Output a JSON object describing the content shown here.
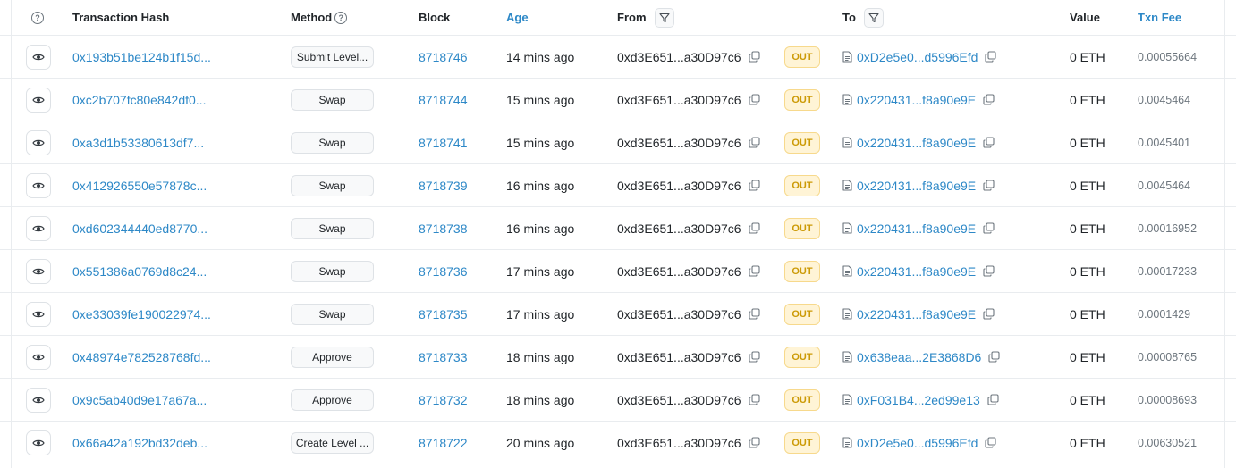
{
  "header": {
    "help_icon": "question-circle-icon",
    "hash": "Transaction Hash",
    "method": "Method",
    "block": "Block",
    "age": "Age",
    "from": "From",
    "to": "To",
    "value": "Value",
    "fee": "Txn Fee"
  },
  "colors": {
    "link": "#2d88c7",
    "out_bg": "#fff4d6",
    "out_text": "#cc9a06"
  },
  "rows": [
    {
      "hash": "0x193b51be124b1f15d...",
      "method": "Submit Level...",
      "block": "8718746",
      "age": "14 mins ago",
      "from": "0xd3E651...a30D97c6",
      "dir": "OUT",
      "to": "0xD2e5e0...d5996Efd",
      "value": "0 ETH",
      "fee": "0.00055664"
    },
    {
      "hash": "0xc2b707fc80e842df0...",
      "method": "Swap",
      "block": "8718744",
      "age": "15 mins ago",
      "from": "0xd3E651...a30D97c6",
      "dir": "OUT",
      "to": "0x220431...f8a90e9E",
      "value": "0 ETH",
      "fee": "0.0045464"
    },
    {
      "hash": "0xa3d1b53380613df7...",
      "method": "Swap",
      "block": "8718741",
      "age": "15 mins ago",
      "from": "0xd3E651...a30D97c6",
      "dir": "OUT",
      "to": "0x220431...f8a90e9E",
      "value": "0 ETH",
      "fee": "0.0045401"
    },
    {
      "hash": "0x412926550e57878c...",
      "method": "Swap",
      "block": "8718739",
      "age": "16 mins ago",
      "from": "0xd3E651...a30D97c6",
      "dir": "OUT",
      "to": "0x220431...f8a90e9E",
      "value": "0 ETH",
      "fee": "0.0045464"
    },
    {
      "hash": "0xd602344440ed8770...",
      "method": "Swap",
      "block": "8718738",
      "age": "16 mins ago",
      "from": "0xd3E651...a30D97c6",
      "dir": "OUT",
      "to": "0x220431...f8a90e9E",
      "value": "0 ETH",
      "fee": "0.00016952"
    },
    {
      "hash": "0x551386a0769d8c24...",
      "method": "Swap",
      "block": "8718736",
      "age": "17 mins ago",
      "from": "0xd3E651...a30D97c6",
      "dir": "OUT",
      "to": "0x220431...f8a90e9E",
      "value": "0 ETH",
      "fee": "0.00017233"
    },
    {
      "hash": "0xe33039fe190022974...",
      "method": "Swap",
      "block": "8718735",
      "age": "17 mins ago",
      "from": "0xd3E651...a30D97c6",
      "dir": "OUT",
      "to": "0x220431...f8a90e9E",
      "value": "0 ETH",
      "fee": "0.0001429"
    },
    {
      "hash": "0x48974e782528768fd...",
      "method": "Approve",
      "block": "8718733",
      "age": "18 mins ago",
      "from": "0xd3E651...a30D97c6",
      "dir": "OUT",
      "to": "0x638eaa...2E3868D6",
      "value": "0 ETH",
      "fee": "0.00008765"
    },
    {
      "hash": "0x9c5ab40d9e17a67a...",
      "method": "Approve",
      "block": "8718732",
      "age": "18 mins ago",
      "from": "0xd3E651...a30D97c6",
      "dir": "OUT",
      "to": "0xF031B4...2ed99e13",
      "value": "0 ETH",
      "fee": "0.00008693"
    },
    {
      "hash": "0x66a42a192bd32deb...",
      "method": "Create Level ...",
      "block": "8718722",
      "age": "20 mins ago",
      "from": "0xd3E651...a30D97c6",
      "dir": "OUT",
      "to": "0xD2e5e0...d5996Efd",
      "value": "0 ETH",
      "fee": "0.00630521"
    }
  ]
}
